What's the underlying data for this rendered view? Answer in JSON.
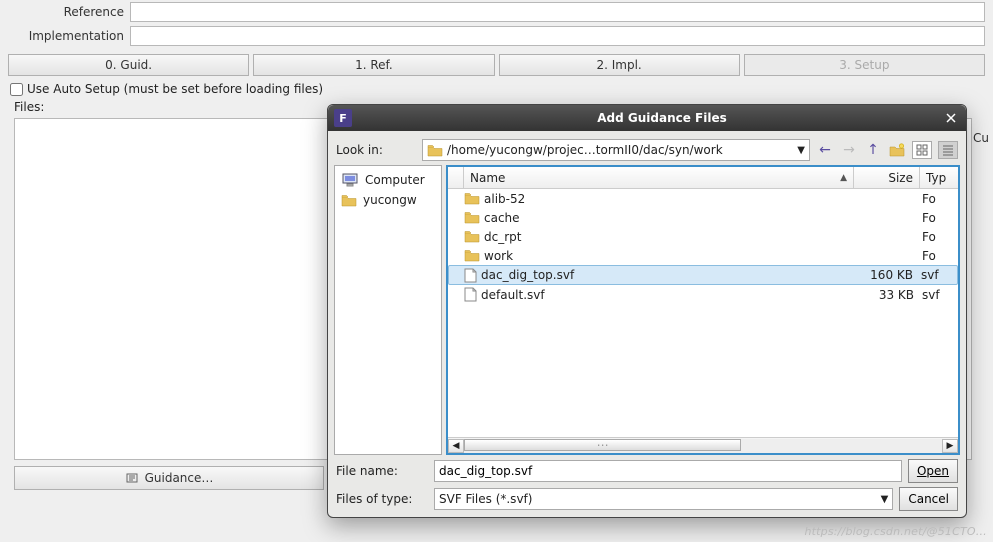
{
  "form": {
    "reference_label": "Reference",
    "implementation_label": "Implementation",
    "reference_value": "",
    "implementation_value": ""
  },
  "tabs": [
    {
      "label": "0. Guid.",
      "disabled": false
    },
    {
      "label": "1. Ref.",
      "disabled": false
    },
    {
      "label": "2. Impl.",
      "disabled": false
    },
    {
      "label": "3. Setup",
      "disabled": true
    }
  ],
  "auto_setup": {
    "checked": false,
    "label": "Use Auto Setup (must be set before loading files)"
  },
  "files_section": {
    "label": "Files:"
  },
  "right_cut": "Cu",
  "guidance_button": "Guidance…",
  "dialog": {
    "title": "Add Guidance Files",
    "badge": "F",
    "look_in_label": "Look in:",
    "path": "/home/yucongw/projec…tormII0/dac/syn/work",
    "places": [
      {
        "kind": "computer",
        "label": "Computer"
      },
      {
        "kind": "folder",
        "label": "yucongw"
      }
    ],
    "columns": {
      "name": "Name",
      "size": "Size",
      "type": "Typ"
    },
    "sort_column": "name",
    "sort_dir": "asc",
    "rows": [
      {
        "kind": "folder",
        "name": "alib-52",
        "size": "",
        "type": "Fo",
        "selected": false
      },
      {
        "kind": "folder",
        "name": "cache",
        "size": "",
        "type": "Fo",
        "selected": false
      },
      {
        "kind": "folder",
        "name": "dc_rpt",
        "size": "",
        "type": "Fo",
        "selected": false
      },
      {
        "kind": "folder",
        "name": "work",
        "size": "",
        "type": "Fo",
        "selected": false
      },
      {
        "kind": "file",
        "name": "dac_dig_top.svf",
        "size": "160 KB",
        "type": "svf",
        "selected": true
      },
      {
        "kind": "file",
        "name": "default.svf",
        "size": "33 KB",
        "type": "svf",
        "selected": false
      }
    ],
    "file_name_label": "File name:",
    "file_name_value": "dac_dig_top.svf",
    "files_of_type_label": "Files of type:",
    "files_of_type_value": "SVF Files (*.svf)",
    "open_btn": "Open",
    "cancel_btn": "Cancel"
  },
  "watermark": "https://blog.csdn.net/@51CTO…"
}
